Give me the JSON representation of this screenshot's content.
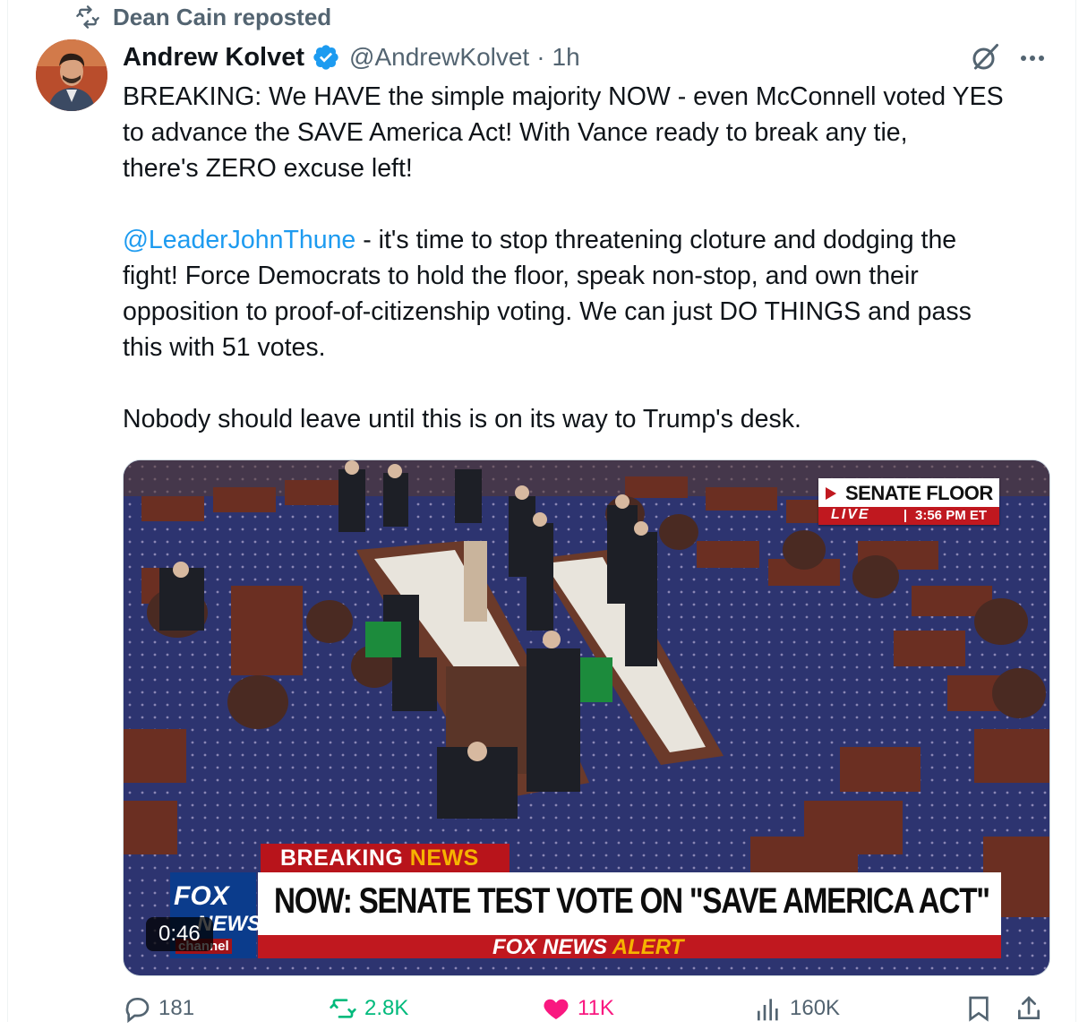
{
  "repost": {
    "icon": "repost-icon",
    "text": "Dean Cain reposted"
  },
  "author": {
    "name": "Andrew Kolvet",
    "handle": "@AndrewKolvet",
    "separator": "·",
    "time": "1h",
    "verified_color": "#1d9bf0"
  },
  "header_icons": {
    "grok": "grok-icon",
    "more": "more-icon"
  },
  "tweet": {
    "para1": "BREAKING: We HAVE the simple majority NOW - even McConnell voted YES\nto advance the SAVE America Act! With Vance ready to break any tie,\nthere's ZERO excuse left!",
    "mention": "@LeaderJohnThune",
    "para2_rest": " - it's time to stop threatening cloture and dodging the\nfight! Force Democrats to hold the floor, speak non-stop, and own their\nopposition to proof-of-citizenship voting. We can just DO THINGS and pass\nthis with 51 votes.",
    "para3": "Nobody should leave until this is on its way to Trump's desk."
  },
  "video": {
    "duration": "0:46",
    "overlay": {
      "location": "SENATE FLOOR",
      "live": "LIVE",
      "time": "3:56 PM ET",
      "tag_breaking": "BREAKING",
      "tag_news": "NEWS",
      "headline": "NOW: SENATE TEST VOTE ON \"SAVE AMERICA ACT\"",
      "alert_brand": "FOX NEWS",
      "alert_word": "ALERT",
      "logo_line1": "FOX",
      "logo_line2": "NEWS",
      "logo_line3": "channel"
    }
  },
  "actions": {
    "replies": "181",
    "reposts": "2.8K",
    "likes": "11K",
    "views": "160K",
    "colors": {
      "muted": "#536471",
      "like": "#f91880",
      "repost": "#00ba7c",
      "link": "#1d9bf0"
    }
  }
}
